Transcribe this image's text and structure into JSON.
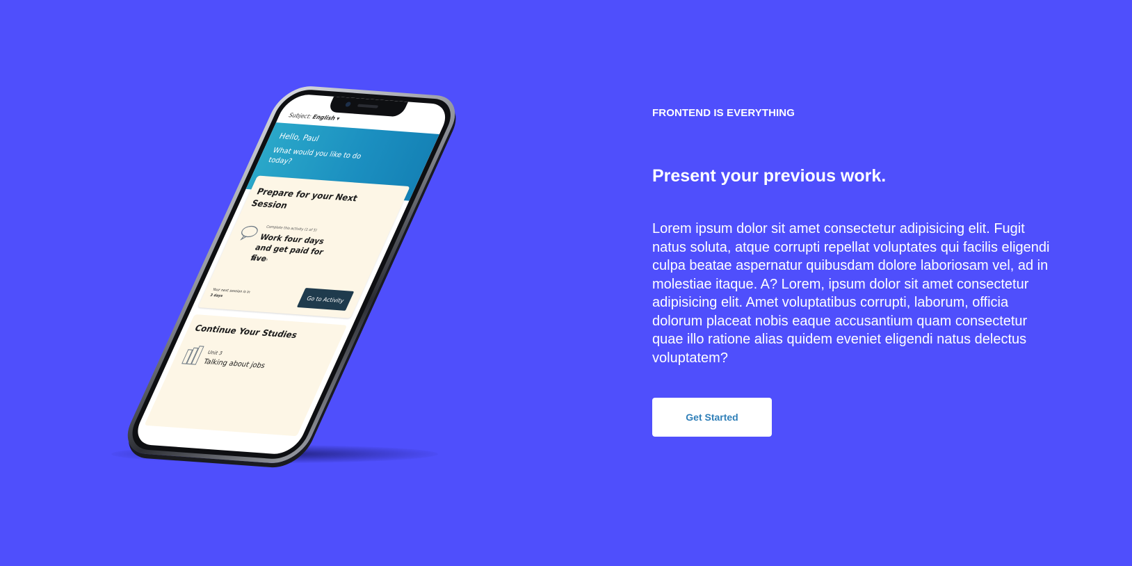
{
  "hero": {
    "kicker": "FRONTEND IS EVERYTHING",
    "headline": "Present your previous work.",
    "body": "Lorem ipsum dolor sit amet consectetur adipisicing elit. Fugit natus soluta, atque corrupti repellat voluptates qui facilis eligendi culpa beatae aspernatur quibusdam dolore laboriosam vel, ad in molestiae itaque. A? Lorem, ipsum dolor sit amet consectetur adipisicing elit. Amet voluptatibus corrupti, laborum, officia dolorum placeat nobis eaque accusantium quam consectetur quae illo ratione alias quidem eveniet eligendi natus delectus voluptatem?",
    "cta_label": "Get Started"
  },
  "phone_app": {
    "subject_label": "Subject:",
    "subject_value": "English",
    "greeting": "Hello, Paul",
    "question": "What would you like to do today?",
    "next_session_title": "Prepare for your Next Session",
    "activity_meta": "Complete this activity (1 of 5)",
    "activity_title": "Work four days and get paid for five",
    "activity_time": "10 min",
    "next_session_text": "Your next session is in",
    "next_session_days": "3 days",
    "go_button": "Go to Activity",
    "continue_title": "Continue Your Studies",
    "unit_label": "Unit 3",
    "unit_title": "Talking about jobs"
  },
  "colors": {
    "background": "#4f4ffc",
    "text": "#ffffff",
    "cta_background": "#ffffff",
    "cta_text": "#2f7fb8"
  },
  "icons": [
    "speech-bubble-icon",
    "books-icon",
    "dropdown-caret-icon"
  ]
}
